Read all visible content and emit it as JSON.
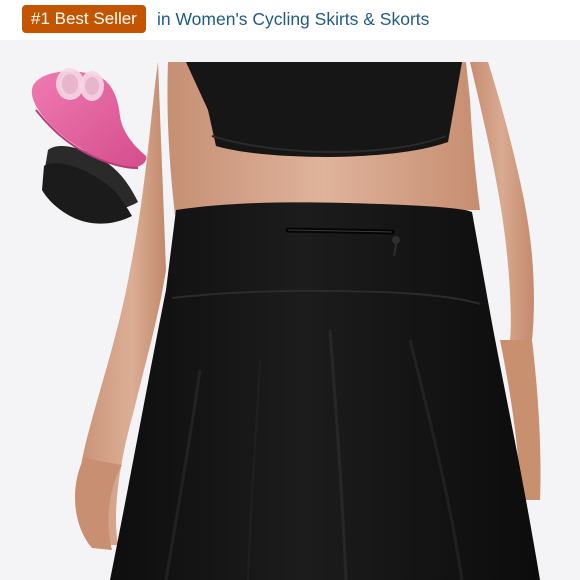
{
  "badge": {
    "label": "#1 Best Seller",
    "color": "#c45500"
  },
  "category": {
    "label": "in Women's Cycling Skirts & Skorts",
    "color": "#1f5b86"
  },
  "image": {
    "background": "#f4f3f5",
    "garment_color": "#141414",
    "skin_color": "#d4a48a",
    "pad_color": "#e2619c"
  }
}
